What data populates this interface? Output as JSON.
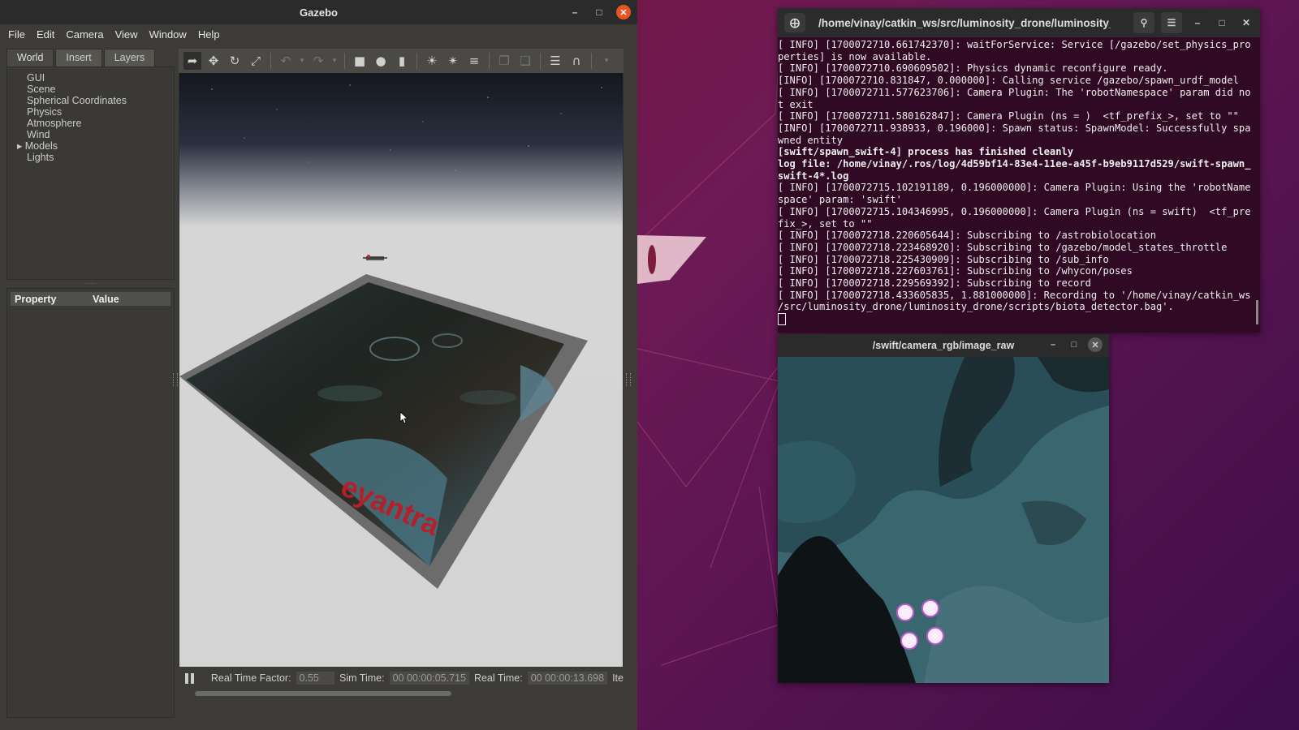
{
  "gazebo": {
    "title": "Gazebo",
    "menu": [
      "File",
      "Edit",
      "Camera",
      "View",
      "Window",
      "Help"
    ],
    "tabs": [
      "World",
      "Insert",
      "Layers"
    ],
    "tree_items": [
      "GUI",
      "Scene",
      "Spherical Coordinates",
      "Physics",
      "Atmosphere",
      "Wind",
      "Models",
      "Lights"
    ],
    "property_header": "Property",
    "value_header": "Value",
    "logo_text": "eyantra",
    "status": {
      "rtf_label": "Real Time Factor:",
      "rtf_value": "0.55",
      "sim_label": "Sim Time:",
      "sim_value": "00 00:00:05.715",
      "real_label": "Real Time:",
      "real_value": "00 00:00:13.698",
      "iter_label": "Ite"
    }
  },
  "terminal": {
    "title": "/home/vinay/catkin_ws/src/luminosity_drone/luminosity_dr...",
    "lines": [
      {
        "text": "[ INFO] [1700072710.661742370]: waitForService: Service [/gazebo/set_physics_pro",
        "bold": false
      },
      {
        "text": "perties] is now available.",
        "bold": false
      },
      {
        "text": "[ INFO] [1700072710.690609502]: Physics dynamic reconfigure ready.",
        "bold": false
      },
      {
        "text": "[INFO] [1700072710.831847, 0.000000]: Calling service /gazebo/spawn_urdf_model",
        "bold": false
      },
      {
        "text": "[ INFO] [1700072711.577623706]: Camera Plugin: The 'robotNamespace' param did no",
        "bold": false
      },
      {
        "text": "t exit",
        "bold": false
      },
      {
        "text": "[ INFO] [1700072711.580162847]: Camera Plugin (ns = )  <tf_prefix_>, set to \"\"",
        "bold": false
      },
      {
        "text": "[INFO] [1700072711.938933, 0.196000]: Spawn status: SpawnModel: Successfully spa",
        "bold": false
      },
      {
        "text": "wned entity",
        "bold": false
      },
      {
        "text": "[swift/spawn_swift-4] process has finished cleanly",
        "bold": true
      },
      {
        "text": "log file: /home/vinay/.ros/log/4d59bf14-83e4-11ee-a45f-b9eb9117d529/swift-spawn_",
        "bold": true
      },
      {
        "text": "swift-4*.log",
        "bold": true
      },
      {
        "text": "[ INFO] [1700072715.102191189, 0.196000000]: Camera Plugin: Using the 'robotName",
        "bold": false
      },
      {
        "text": "space' param: 'swift'",
        "bold": false
      },
      {
        "text": "[ INFO] [1700072715.104346995, 0.196000000]: Camera Plugin (ns = swift)  <tf_pre",
        "bold": false
      },
      {
        "text": "fix_>, set to \"\"",
        "bold": false
      },
      {
        "text": "[ INFO] [1700072718.220605644]: Subscribing to /astrobiolocation",
        "bold": false
      },
      {
        "text": "[ INFO] [1700072718.223468920]: Subscribing to /gazebo/model_states_throttle",
        "bold": false
      },
      {
        "text": "[ INFO] [1700072718.225430909]: Subscribing to /sub_info",
        "bold": false
      },
      {
        "text": "[ INFO] [1700072718.227603761]: Subscribing to /whycon/poses",
        "bold": false
      },
      {
        "text": "[ INFO] [1700072718.229569392]: Subscribing to record",
        "bold": false
      },
      {
        "text": "[ INFO] [1700072718.433605835, 1.881000000]: Recording to '/home/vinay/catkin_ws",
        "bold": false
      },
      {
        "text": "/src/luminosity_drone/luminosity_drone/scripts/biota_detector.bag'.",
        "bold": false
      }
    ]
  },
  "image_view": {
    "title": "/swift/camera_rgb/image_raw"
  },
  "colors": {
    "ubuntu_orange": "#e95420",
    "terminal_bg": "#300a24",
    "gazebo_bg": "#3c3b37"
  }
}
